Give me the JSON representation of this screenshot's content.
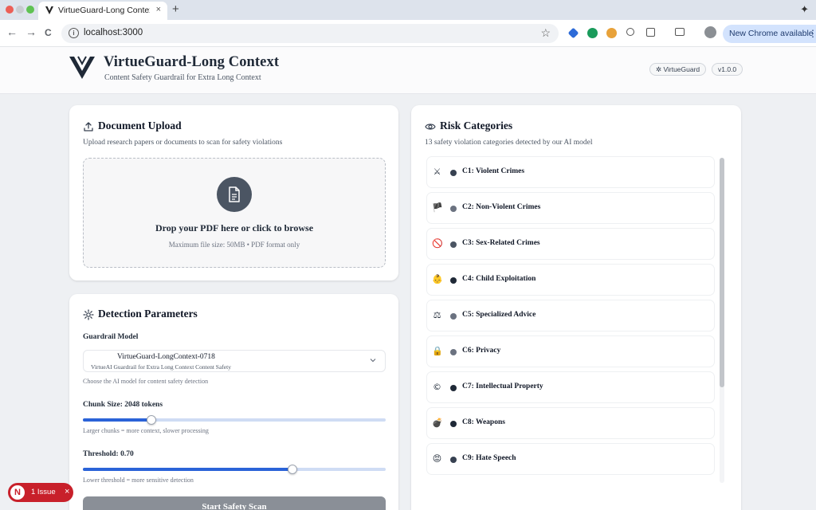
{
  "browser": {
    "tab_title": "VirtueGuard-Long Context - ",
    "tab_close": "×",
    "new_tab": "+",
    "back": "←",
    "forward": "→",
    "reload": "C",
    "url": "localhost:3000",
    "bookmark": "☆",
    "update_button": "New Chrome available",
    "menu": "⋮"
  },
  "header": {
    "title": "VirtueGuard-Long Context",
    "subtitle": "Content Safety Guardrail for Extra Long Context",
    "badge_brand": "✲ VirtueGuard",
    "badge_version": "v1.0.0"
  },
  "upload": {
    "title": "Document Upload",
    "description": "Upload research papers or documents to scan for safety violations",
    "drop_title": "Drop your PDF here or click to browse",
    "drop_note": "Maximum file size: 50MB • PDF format only"
  },
  "params": {
    "title": "Detection Parameters",
    "model_label": "Guardrail Model",
    "model_name": "VirtueGuard-LongContext-0718",
    "model_desc": "VirtueAI Guardrail for Extra Long Context Content Safety",
    "model_help": "Choose the AI model for content safety detection",
    "chunk_label": "Chunk Size: 2048 tokens",
    "chunk_fraction": 0.225,
    "chunk_help": "Larger chunks = more context, slower processing",
    "threshold_label": "Threshold: 0.70",
    "threshold_fraction": 0.692,
    "threshold_help": "Lower threshold = more sensitive detection",
    "scan_button": "Start Safety Scan"
  },
  "risk": {
    "title": "Risk Categories",
    "description": "13 safety violation categories detected by our AI model",
    "categories": [
      {
        "emoji": "⚔",
        "label": "C1: Violent Crimes",
        "dot": "#374151"
      },
      {
        "emoji": "🏴",
        "label": "C2: Non-Violent Crimes",
        "dot": "#6b7280"
      },
      {
        "emoji": "🚫",
        "label": "C3: Sex-Related Crimes",
        "dot": "#4b5563"
      },
      {
        "emoji": "👶",
        "label": "C4: Child Exploitation",
        "dot": "#1f2937"
      },
      {
        "emoji": "⚖",
        "label": "C5: Specialized Advice",
        "dot": "#6b7280"
      },
      {
        "emoji": "🔒",
        "label": "C6: Privacy",
        "dot": "#6b7280"
      },
      {
        "emoji": "©",
        "label": "C7: Intellectual Property",
        "dot": "#1f2937"
      },
      {
        "emoji": "💣",
        "label": "C8: Weapons",
        "dot": "#1f2937"
      },
      {
        "emoji": "😡",
        "label": "C9: Hate Speech",
        "dot": "#374151"
      }
    ]
  },
  "issue": {
    "initial": "N",
    "text": "1 Issue",
    "close": "×"
  }
}
